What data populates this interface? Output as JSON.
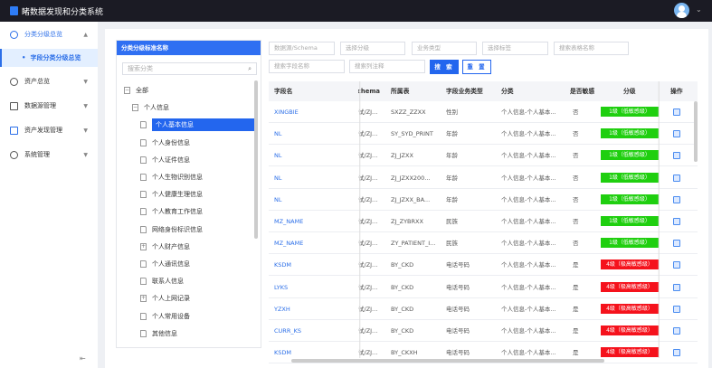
{
  "app": {
    "title": "睹数据发现和分类系统"
  },
  "sidebar": {
    "items": [
      {
        "label": "分类分级总览",
        "icon": "dashboard-icon",
        "open": true,
        "sub": [
          "字段分类分级总览"
        ]
      },
      {
        "label": "资产总览",
        "icon": "dashboard-icon"
      },
      {
        "label": "数据源管理",
        "icon": "database-icon"
      },
      {
        "label": "资产发现管理",
        "icon": "discover-icon"
      },
      {
        "label": "系统管理",
        "icon": "settings-icon"
      }
    ]
  },
  "tree": {
    "title": "分类分级标准名称",
    "search_placeholder": "搜索分类",
    "nodes": [
      {
        "label": "全部",
        "level": 0,
        "icon": "minus"
      },
      {
        "label": "个人信息",
        "level": 1,
        "icon": "minus"
      },
      {
        "label": "个人基本信息",
        "level": 2,
        "icon": "file",
        "selected": true
      },
      {
        "label": "个人身份信息",
        "level": 2,
        "icon": "file"
      },
      {
        "label": "个人证件信息",
        "level": 2,
        "icon": "file"
      },
      {
        "label": "个人生物识别信息",
        "level": 2,
        "icon": "file"
      },
      {
        "label": "个人健康生理信息",
        "level": 2,
        "icon": "file"
      },
      {
        "label": "个人教育工作信息",
        "level": 2,
        "icon": "file"
      },
      {
        "label": "网络身份标识信息",
        "level": 2,
        "icon": "file"
      },
      {
        "label": "个人财产信息",
        "level": 2,
        "icon": "plus"
      },
      {
        "label": "个人通讯信息",
        "level": 2,
        "icon": "file"
      },
      {
        "label": "联系人信息",
        "level": 2,
        "icon": "file"
      },
      {
        "label": "个人上网记录",
        "level": 2,
        "icon": "plus"
      },
      {
        "label": "个人常用设备",
        "level": 2,
        "icon": "file"
      },
      {
        "label": "其他信息",
        "level": 2,
        "icon": "file"
      }
    ]
  },
  "filters": {
    "datasource": "数据源/Schema",
    "level": "选择分级",
    "biz_type": "业务类型",
    "tag": "选择标签",
    "table_name": "搜索表格名称",
    "field_name": "搜索字段名称",
    "column_comment": "搜索列注释",
    "search": "搜 索",
    "reset": "重 置"
  },
  "table": {
    "headers": [
      "字段名",
      "Schema",
      "所属表",
      "字段业务类型",
      "分类",
      "是否敏感",
      "分级",
      "操作"
    ],
    "rows": [
      [
        "XINGBIE",
        "试/ZJ...",
        "SXZZ_ZZXX",
        "性别",
        "个人信息-个人基本...",
        "否",
        "1级（低敏感级）"
      ],
      [
        "NL",
        "试/ZJ...",
        "SY_SYD_PRINT",
        "年龄",
        "个人信息-个人基本...",
        "否",
        "1级（低敏感级）"
      ],
      [
        "NL",
        "试/ZJ...",
        "ZJ_JZXX",
        "年龄",
        "个人信息-个人基本...",
        "否",
        "1级（低敏感级）"
      ],
      [
        "NL",
        "试/ZJ...",
        "ZJ_JZXX200...",
        "年龄",
        "个人信息-个人基本...",
        "否",
        "1级（低敏感级）"
      ],
      [
        "NL",
        "试/ZJ...",
        "ZJ_JZXX_BA...",
        "年龄",
        "个人信息-个人基本...",
        "否",
        "1级（低敏感级）"
      ],
      [
        "MZ_NAME",
        "试/ZJ...",
        "ZJ_ZYBRXX",
        "民族",
        "个人信息-个人基本...",
        "否",
        "1级（低敏感级）"
      ],
      [
        "MZ_NAME",
        "试/ZJ...",
        "ZY_PATIENT_I...",
        "民族",
        "个人信息-个人基本...",
        "否",
        "1级（低敏感级）"
      ],
      [
        "KSDM",
        "试/ZJ...",
        "BY_CKD",
        "电话号码",
        "个人信息-个人基本...",
        "是",
        "4级（极高敏感级）"
      ],
      [
        "LYKS",
        "试/ZJ...",
        "BY_CKD",
        "电话号码",
        "个人信息-个人基本...",
        "是",
        "4级（极高敏感级）"
      ],
      [
        "YZXH",
        "试/ZJ...",
        "BY_CKD",
        "电话号码",
        "个人信息-个人基本...",
        "是",
        "4级（极高敏感级）"
      ],
      [
        "CURR_KS",
        "试/ZJ...",
        "BY_CKD",
        "电话号码",
        "个人信息-个人基本...",
        "是",
        "4级（极高敏感级）"
      ],
      [
        "KSDM",
        "试/ZJ...",
        "BY_CKXH",
        "电话号码",
        "个人信息-个人基本...",
        "是",
        "4级（极高敏感级）"
      ]
    ]
  },
  "colors": {
    "accent": "#2366ee",
    "level1": "#1fcf0f",
    "level4": "#f5121c"
  }
}
